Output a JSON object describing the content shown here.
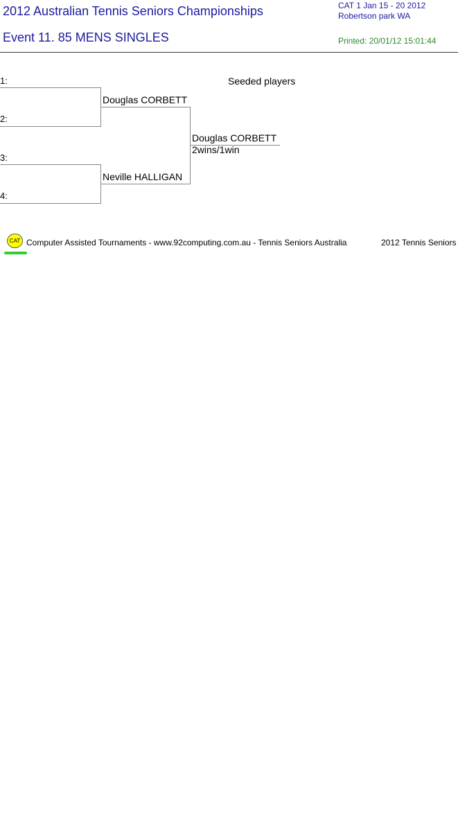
{
  "header": {
    "title": "2012 Australian Tennis Seniors Championships",
    "event": "Event 11. 85 MENS SINGLES",
    "category_dates": "CAT 1   Jan 15 - 20 2012",
    "venue": "Robertson park   WA",
    "printed": "Printed: 20/01/12 15:01:44"
  },
  "draw": {
    "seeded_label": "Seeded players",
    "slots": [
      "1:",
      "2:",
      "3:",
      "4:"
    ],
    "round2": [
      "Douglas CORBETT",
      "Neville HALLIGAN"
    ],
    "winner": "Douglas CORBETT",
    "score": "2wins/1win"
  },
  "footer": {
    "logo_text": "CAT",
    "credits": "Computer Assisted Tournaments - www.92computing.com.au -  Tennis Seniors Australia",
    "event_short": "2012 Tennis Seniors"
  }
}
